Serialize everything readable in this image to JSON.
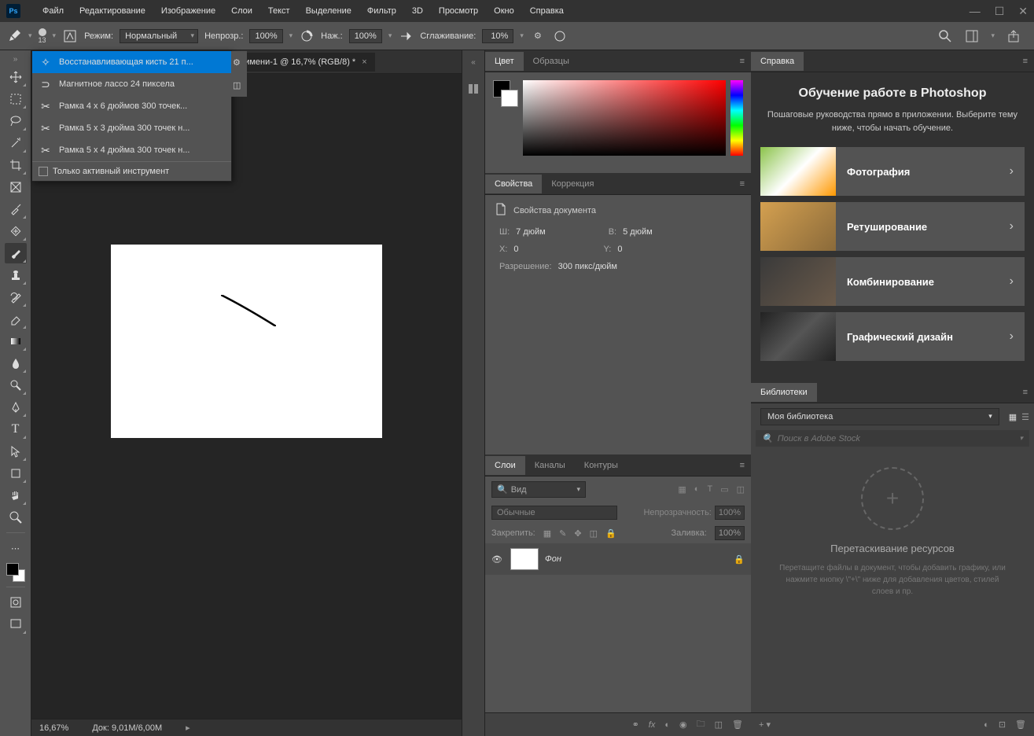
{
  "app": {
    "logo": "Ps"
  },
  "menu": [
    "Файл",
    "Редактирование",
    "Изображение",
    "Слои",
    "Текст",
    "Выделение",
    "Фильтр",
    "3D",
    "Просмотр",
    "Окно",
    "Справка"
  ],
  "options": {
    "brush_size": "13",
    "mode_label": "Режим:",
    "mode_value": "Нормальный",
    "opacity_label": "Непрозр.:",
    "opacity_value": "100%",
    "flow_label": "Наж.:",
    "flow_value": "100%",
    "smoothing_label": "Сглаживание:",
    "smoothing_value": "10%"
  },
  "presets": {
    "items": [
      "Восстанавливающая кисть 21 п...",
      "Магнитное лассо 24 пиксела",
      "Рамка 4 x 6 дюймов 300 точек...",
      "Рамка 5 x 3 дюйма 300 точек н...",
      "Рамка 5 x 4 дюйма 300 точек н..."
    ],
    "footer": "Только активный инструмент"
  },
  "document": {
    "tab_title": "Без имени-1 @ 16,7% (RGB/8) *"
  },
  "status": {
    "zoom": "16,67%",
    "doc_label": "Док:",
    "doc_size": "9,01M/6,00M"
  },
  "panels": {
    "color": {
      "tab1": "Цвет",
      "tab2": "Образцы"
    },
    "properties": {
      "tab1": "Свойства",
      "tab2": "Коррекция",
      "header": "Свойства документа",
      "w_label": "Ш:",
      "w_value": "7 дюйм",
      "h_label": "В:",
      "h_value": "5 дюйм",
      "x_label": "X:",
      "x_value": "0",
      "y_label": "Y:",
      "y_value": "0",
      "res_label": "Разрешение:",
      "res_value": "300 пикс/дюйм"
    },
    "layers": {
      "tab1": "Слои",
      "tab2": "Каналы",
      "tab3": "Контуры",
      "search_placeholder": "Вид",
      "blend": "Обычные",
      "opacity_label": "Непрозрачность:",
      "opacity_value": "100%",
      "lock_label": "Закрепить:",
      "fill_label": "Заливка:",
      "fill_value": "100%",
      "layer_name": "Фон"
    },
    "help": {
      "tab": "Справка",
      "title": "Обучение работе в Photoshop",
      "subtitle": "Пошаговые руководства прямо в приложении. Выберите тему ниже, чтобы начать обучение.",
      "cards": [
        "Фотография",
        "Ретуширование",
        "Комбинирование",
        "Графический дизайн"
      ]
    },
    "libraries": {
      "tab": "Библиотеки",
      "select": "Моя библиотека",
      "search_placeholder": "Поиск в Adobe Stock",
      "drop_title": "Перетаскивание ресурсов",
      "drop_text": "Перетащите файлы в документ, чтобы добавить графику, или нажмите кнопку \\\"+\\\" ниже для добавления цветов, стилей слоев и пр."
    }
  }
}
